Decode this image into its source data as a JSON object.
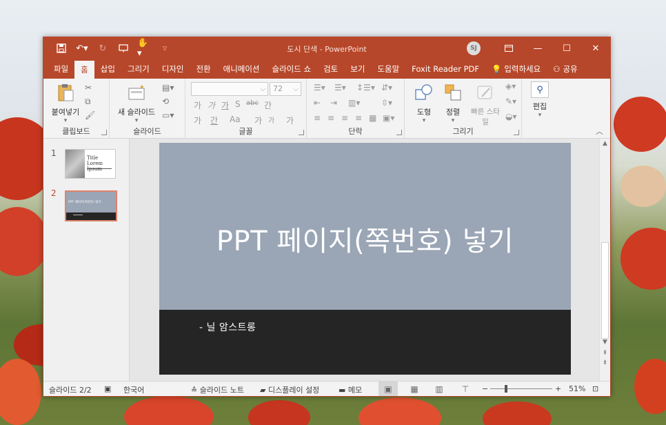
{
  "window": {
    "title": "도시 단색 - PowerPoint",
    "user_initials": "SJ",
    "controls": [
      "ribbon-display-icon",
      "minimize-icon",
      "maximize-icon",
      "close-icon"
    ]
  },
  "qat": [
    "save-icon",
    "undo-icon",
    "redo-icon",
    "present-icon",
    "touch-mode-icon",
    "customize-icon"
  ],
  "tabs": [
    {
      "label": "파일"
    },
    {
      "label": "홈",
      "active": true
    },
    {
      "label": "삽입"
    },
    {
      "label": "그리기"
    },
    {
      "label": "디자인"
    },
    {
      "label": "전환"
    },
    {
      "label": "애니메이션"
    },
    {
      "label": "슬라이드 쇼"
    },
    {
      "label": "검토"
    },
    {
      "label": "보기"
    },
    {
      "label": "도움말"
    },
    {
      "label": "Foxit Reader PDF"
    }
  ],
  "tell_me": "입력하세요",
  "share": "공유",
  "ribbon": {
    "clipboard": {
      "paste": "붙여넣기",
      "label": "클립보드"
    },
    "slides": {
      "new_slide": "새 슬라이드",
      "label": "슬라이드"
    },
    "font": {
      "size": "72",
      "row1": [
        "가",
        "가",
        "가",
        "S",
        "abc",
        "간"
      ],
      "row2": [
        "가",
        "간",
        "Aa",
        "가",
        "가",
        "가"
      ],
      "label": "글꼴"
    },
    "paragraph": {
      "label": "단락"
    },
    "drawing": {
      "shapes": "도형",
      "arrange": "정렬",
      "quick_styles": "빠른 스타일",
      "label": "그리기"
    },
    "editing": {
      "edit": "편집"
    }
  },
  "slides": [
    {
      "number": "1",
      "thumb_title": "Title Lorem Ipsum"
    },
    {
      "number": "2",
      "thumb_title": "PPT 페이지(쪽번호) 넣기",
      "selected": true
    }
  ],
  "current_slide": {
    "title": "PPT 페이지(쪽번호) 넣기",
    "subtitle": "- 닐 암스트롱",
    "colors": {
      "top": "#9aa5b5",
      "band": "#252525"
    }
  },
  "status": {
    "slide_info": "슬라이드 2/2",
    "language": "한국어",
    "notes": "슬라이드 노트",
    "display_settings": "디스플레이 설정",
    "comments": "메모",
    "zoom_minus": "−",
    "zoom_plus": "+",
    "zoom": "51%",
    "zoom_fraction": 0.51
  },
  "theme": {
    "accent": "#b7472a"
  }
}
